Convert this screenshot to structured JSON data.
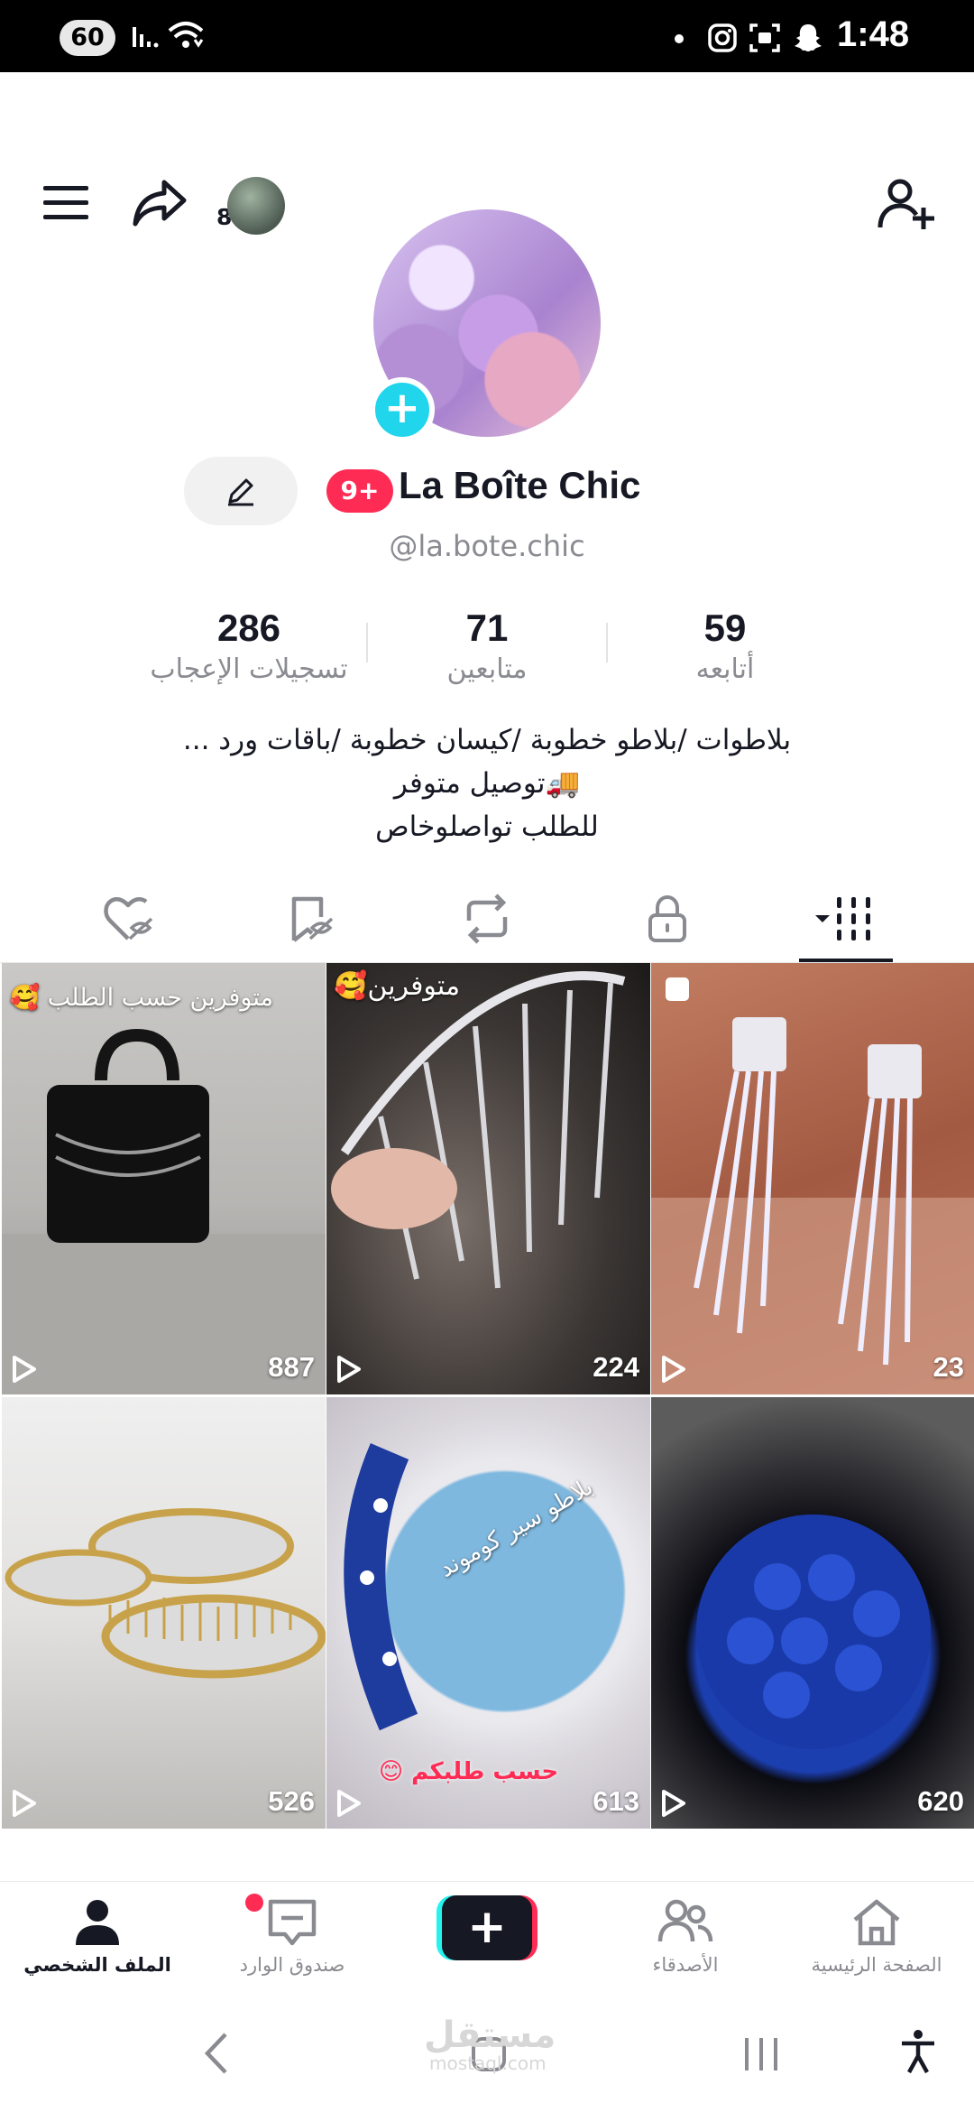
{
  "status_bar": {
    "battery": "60",
    "time": "1:48",
    "icons": [
      "signal-icon",
      "wifi-icon",
      "instagram-icon",
      "screenshot-icon",
      "snapchat-icon"
    ]
  },
  "header": {
    "friends_count": "8",
    "icons": [
      "menu-icon",
      "share-icon",
      "add-user-icon"
    ]
  },
  "profile": {
    "badge": "9+",
    "display_name": "La Boîte Chic",
    "username": "@la.bote.chic"
  },
  "stats": [
    {
      "value": "59",
      "label": "أتابعه"
    },
    {
      "value": "71",
      "label": "متابعين"
    },
    {
      "value": "286",
      "label": "تسجيلات الإعجاب"
    }
  ],
  "bio": [
    "بلاطوات /بلاطو خطوبة /كيسان خطوبة /باقات ورد ...",
    "🚚توصيل متوفر",
    "للطلب تواصلوخاص"
  ],
  "tabs": [
    "videos-tab",
    "private-tab",
    "reposts-tab",
    "favorites-tab",
    "liked-tab"
  ],
  "videos": [
    {
      "views": "887",
      "caption": "متوفرين حسب الطلب 🥰"
    },
    {
      "views": "224",
      "caption": "متوفرين🥰"
    },
    {
      "views": "23",
      "caption": ""
    },
    {
      "views": "526",
      "caption": ""
    },
    {
      "views": "613",
      "caption": "حسب طلبكم 😊",
      "overlay_text": "بلاطو سير كوموند"
    },
    {
      "views": "620",
      "caption": ""
    }
  ],
  "bottom_nav": [
    {
      "label": "الصفحة الرئيسية"
    },
    {
      "label": "الأصدقاء"
    },
    {
      "label": ""
    },
    {
      "label": "صندوق الوارد"
    },
    {
      "label": "الملف الشخصي"
    }
  ],
  "watermark": {
    "main": "مستقل",
    "sub": "mostaql.com"
  },
  "colors": {
    "accent": "#fe2c55",
    "cyan": "#25f4ee",
    "add_avatar": "#20d5ec",
    "text": "#161823",
    "muted": "#8a8b91"
  }
}
